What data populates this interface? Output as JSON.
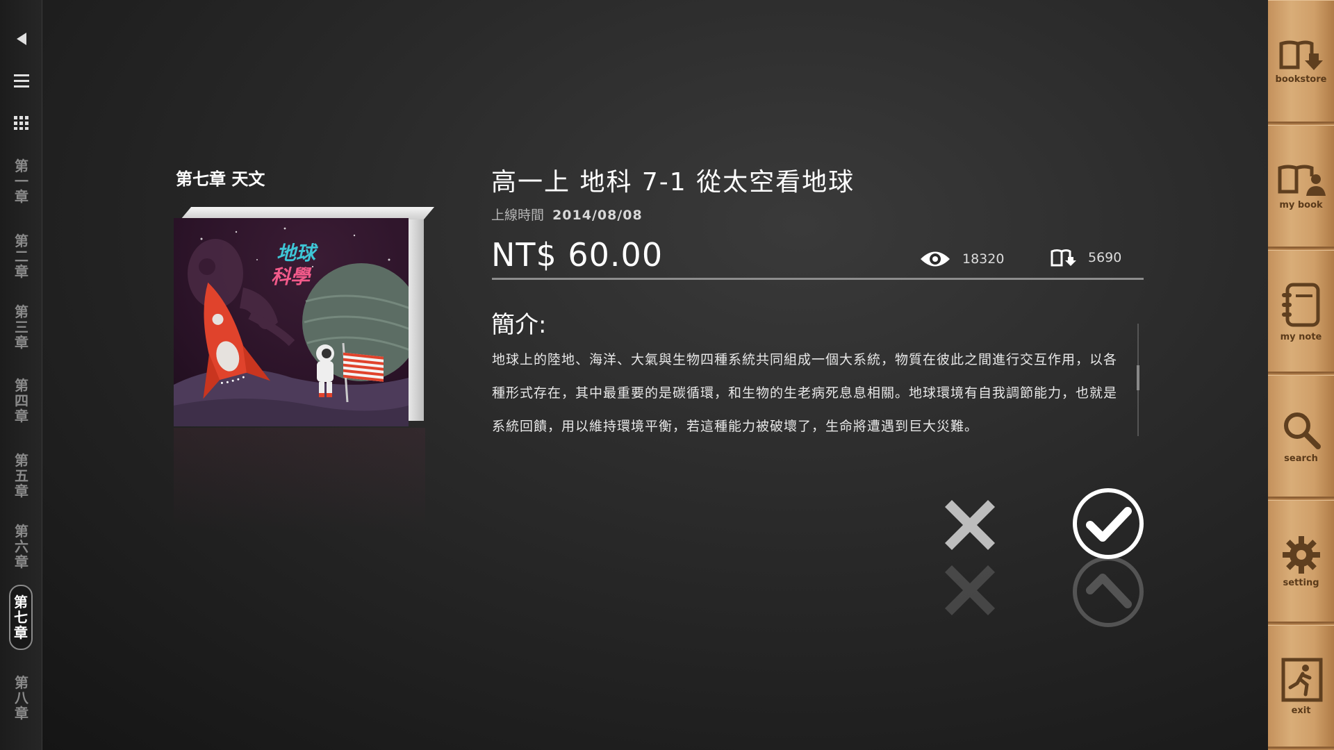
{
  "sidebar": {
    "chapters": [
      {
        "chars": [
          "第",
          "一",
          "章"
        ]
      },
      {
        "chars": [
          "第",
          "二",
          "章"
        ]
      },
      {
        "chars": [
          "第",
          "三",
          "章"
        ]
      },
      {
        "chars": [
          "第",
          "四",
          "章"
        ]
      },
      {
        "chars": [
          "第",
          "五",
          "章"
        ]
      },
      {
        "chars": [
          "第",
          "六",
          "章"
        ]
      },
      {
        "chars": [
          "第",
          "七",
          "章"
        ],
        "active": true
      },
      {
        "chars": [
          "第",
          "八",
          "章"
        ]
      }
    ],
    "icons": [
      "back-arrow-icon",
      "menu-list-icon",
      "grid-icon"
    ]
  },
  "right_menu": {
    "items": [
      {
        "label": "bookstore",
        "icon": "bookstore-download-icon"
      },
      {
        "label": "my book",
        "icon": "my-book-icon"
      },
      {
        "label": "my note",
        "icon": "notebook-icon"
      },
      {
        "label": "search",
        "icon": "search-icon"
      },
      {
        "label": "setting",
        "icon": "gear-icon"
      },
      {
        "label": "exit",
        "icon": "exit-icon"
      }
    ]
  },
  "book": {
    "chapter_title": "第七章 天文",
    "cover_title_line1": "地球",
    "cover_title_line2": "科學",
    "title": "高一上 地科 7-1 從太空看地球",
    "date_label": "上線時間",
    "date_value": "2014/08/08",
    "price": "NT$ 60.00",
    "views": "18320",
    "downloads": "5690",
    "intro_title": "簡介:",
    "intro_text": "地球上的陸地、海洋、大氣與生物四種系統共同組成一個大系統，物質在彼此之間進行交互作用，以各種形式存在，其中最重要的是碳循環，和生物的生老病死息息相關。地球環境有自我調節能力，也就是系統回饋，用以維持環境平衡，若這種能力被破壞了，生命將遭遇到巨大災難。"
  },
  "colors": {
    "background": "#2a2a2a",
    "wood": "#d2a26c",
    "cover_bg": "#2b1328",
    "cover_title_cyan": "#3ec6d6",
    "cover_title_pink": "#f25a8a",
    "rocket_red": "#e0432c"
  }
}
